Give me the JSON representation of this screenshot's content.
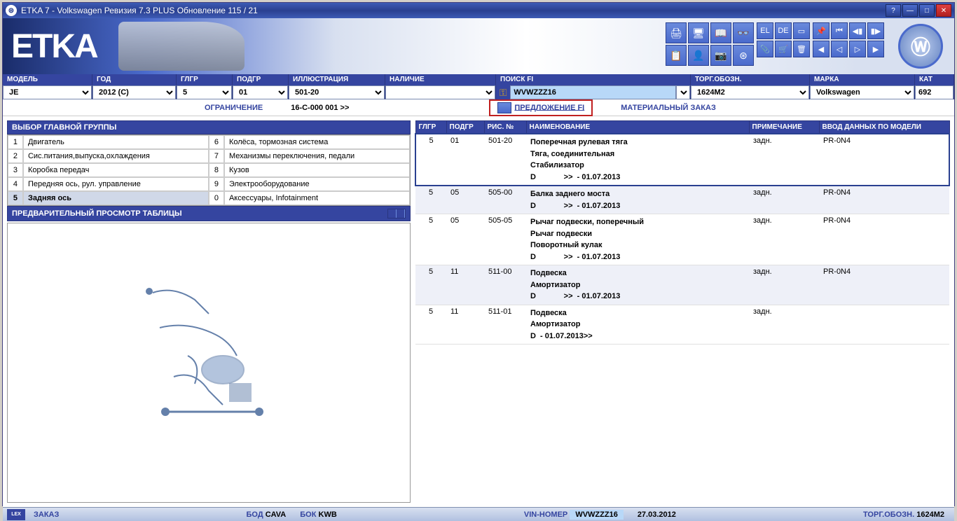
{
  "window": {
    "title": "ETKA 7 - Volkswagen Ревизия 7.3 PLUS Обновление 115 / 21"
  },
  "logo": "ETKA",
  "fields": {
    "model": {
      "label": "МОДЕЛЬ",
      "value": "JE"
    },
    "year": {
      "label": "ГОД",
      "value": "2012 (C)"
    },
    "glgr": {
      "label": "ГЛГР",
      "value": "5"
    },
    "podgr": {
      "label": "ПОДГР",
      "value": "01"
    },
    "illust": {
      "label": "ИЛЛЮСТРАЦИЯ",
      "value": "501-20"
    },
    "stock": {
      "label": "НАЛИЧИЕ",
      "value": ""
    },
    "search": {
      "label": "ПОИСК FI",
      "value": "WVWZZZ16"
    },
    "trade": {
      "label": "ТОРГ.ОБОЗН.",
      "value": "1624M2"
    },
    "brand": {
      "label": "МАРКА",
      "value": "Volkswagen"
    },
    "cat": {
      "label": "КАТ",
      "value": "692"
    }
  },
  "midbar": {
    "restriction_label": "ОГРАНИЧЕНИЕ",
    "restriction_value": "16-C-000 001 >>",
    "offer": "ПРЕДЛОЖЕНИЕ FI",
    "material": "МАТЕРИАЛЬНЫЙ ЗАКАЗ"
  },
  "leftpanel": {
    "title": "ВЫБОР ГЛАВНОЙ ГРУППЫ",
    "preview_title": "ПРЕДВАРИТЕЛЬНЫЙ ПРОСМОТР ТАБЛИЦЫ",
    "groups_left": [
      {
        "n": "1",
        "t": "Двигатель"
      },
      {
        "n": "2",
        "t": "Сис.питания,выпуска,охлаждения"
      },
      {
        "n": "3",
        "t": "Коробка передач"
      },
      {
        "n": "4",
        "t": "Передняя ось, рул. управление"
      },
      {
        "n": "5",
        "t": "Задняя ось"
      }
    ],
    "groups_right": [
      {
        "n": "6",
        "t": "Колёса, тормозная система"
      },
      {
        "n": "7",
        "t": "Механизмы переключения, педали"
      },
      {
        "n": "8",
        "t": "Кузов"
      },
      {
        "n": "9",
        "t": "Электрооборудование"
      },
      {
        "n": "0",
        "t": "Аксессуары, Infotainment"
      }
    ]
  },
  "table": {
    "headers": {
      "glgr": "ГЛГР",
      "podgr": "ПОДГР",
      "fig": "РИС. №",
      "name": "НАИМЕНОВАНИЕ",
      "note": "ПРИМЕЧАНИЕ",
      "model": "ВВОД ДАННЫХ ПО МОДЕЛИ"
    },
    "rows": [
      {
        "glgr": "5",
        "podgr": "01",
        "fig": "501-20",
        "names": [
          "Поперечная рулевая тяга",
          "Тяга, соединительная",
          "Стабилизатор",
          "D             >>  - 01.07.2013"
        ],
        "note": "задн.",
        "model": "PR-0N4",
        "hl": true,
        "striped": false
      },
      {
        "glgr": "5",
        "podgr": "05",
        "fig": "505-00",
        "names": [
          "Балка заднего моста",
          "D             >>  - 01.07.2013"
        ],
        "note": "задн.",
        "model": "PR-0N4",
        "hl": false,
        "striped": true
      },
      {
        "glgr": "5",
        "podgr": "05",
        "fig": "505-05",
        "names": [
          "Рычаг подвески, поперечный",
          "Рычаг подвески",
          "Поворотный кулак",
          "D             >>  - 01.07.2013"
        ],
        "note": "задн.",
        "model": "PR-0N4",
        "hl": false,
        "striped": false
      },
      {
        "glgr": "5",
        "podgr": "11",
        "fig": "511-00",
        "names": [
          "Подвеска",
          "Амортизатор",
          "D             >>  - 01.07.2013"
        ],
        "note": "задн.",
        "model": "PR-0N4",
        "hl": false,
        "striped": true
      },
      {
        "glgr": "5",
        "podgr": "11",
        "fig": "511-01",
        "names": [
          "Подвеска",
          "Амортизатор",
          "D  - 01.07.2013>>"
        ],
        "note": "задн.",
        "model": "",
        "hl": false,
        "striped": false
      }
    ]
  },
  "footer": {
    "order": "ЗАКАЗ",
    "bod_l": "БОД",
    "bod_v": "CAVA",
    "bok_l": "БОК",
    "bok_v": "KWB",
    "vin_l": "VIN-НОМЕР",
    "vin_v": "WVWZZZ16",
    "date": "27.03.2012",
    "trade_l": "ТОРГ.ОБОЗН.",
    "trade_v": "1624M2"
  }
}
